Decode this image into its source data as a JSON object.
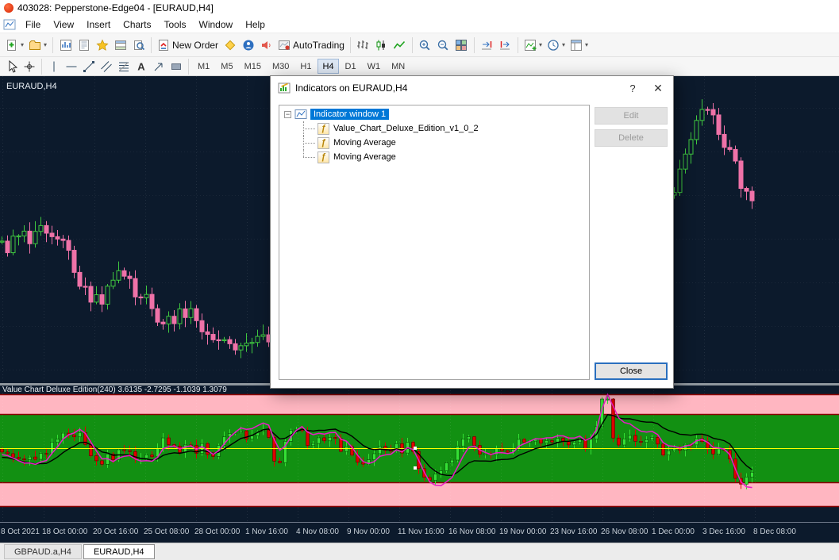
{
  "colors": {
    "chart_bg": "#0c1a2c",
    "candle_up": "#3fc83f",
    "candle_down": "#ef72a8",
    "band_green": "#129012",
    "band_pink": "#ffb6c1",
    "band_edge": "#8b0000",
    "bar_up": "#35e035",
    "bar_down": "#dd0000",
    "ma_magenta": "#e81cc8",
    "ma_black": "#000000",
    "center_line": "#ffff00",
    "accent_blue": "#0078d7"
  },
  "icons": {
    "caret": "▾",
    "expander_collapse": "−",
    "function": "ƒ",
    "help": "?",
    "close": "✕",
    "text_tool": "A"
  },
  "titlebar": {
    "title": "403028: Pepperstone-Edge04 - [EURAUD,H4]"
  },
  "menubar": {
    "items": [
      "File",
      "View",
      "Insert",
      "Charts",
      "Tools",
      "Window",
      "Help"
    ]
  },
  "toolbar": {
    "new_order": "New Order",
    "autotrading": "AutoTrading"
  },
  "timeframes": {
    "items": [
      "M1",
      "M5",
      "M15",
      "M30",
      "H1",
      "H4",
      "D1",
      "W1",
      "MN"
    ],
    "active": "H4"
  },
  "chart": {
    "symbol_label": "EURAUD,H4"
  },
  "indicator_panel": {
    "label": "Value Chart Deluxe Edition(240) 3.6135 -2.7295 -1.1039 1.3079"
  },
  "dialog": {
    "title": "Indicators on EURAUD,H4",
    "tree_root": "Indicator window 1",
    "tree_children": [
      "Value_Chart_Deluxe_Edition_v1_0_2",
      "Moving Average",
      "Moving Average"
    ],
    "edit": "Edit",
    "delete": "Delete",
    "close_button": "Close"
  },
  "time_axis": {
    "labels": [
      "8 Oct 2021",
      "18 Oct 00:00",
      "20 Oct 16:00",
      "25 Oct 08:00",
      "28 Oct 00:00",
      "1 Nov 16:00",
      "4 Nov 08:00",
      "9 Nov 00:00",
      "11 Nov 16:00",
      "16 Nov 08:00",
      "19 Nov 00:00",
      "23 Nov 16:00",
      "26 Nov 08:00",
      "1 Dec 00:00",
      "3 Dec 16:00",
      "8 Dec 08:00"
    ]
  },
  "tabs": {
    "items": [
      "GBPAUD.a,H4",
      "EURAUD,H4"
    ],
    "active": "EURAUD,H4"
  }
}
